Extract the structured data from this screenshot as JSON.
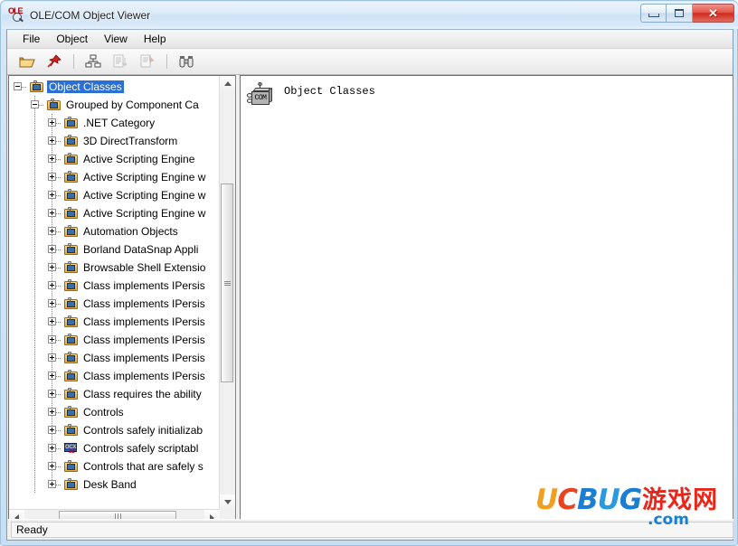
{
  "window": {
    "title": "OLE/COM Object Viewer",
    "app_icon": "ole-viewer-icon",
    "minimize_label": "–",
    "maximize_label": "□",
    "close_label": "✕"
  },
  "menu": {
    "items": [
      {
        "label": "File",
        "name": "menu-file"
      },
      {
        "label": "Object",
        "name": "menu-object"
      },
      {
        "label": "View",
        "name": "menu-view"
      },
      {
        "label": "Help",
        "name": "menu-help"
      }
    ]
  },
  "toolbar": {
    "buttons": [
      {
        "icon": "open-folder-icon",
        "enabled": true
      },
      {
        "icon": "red-pushpin-icon",
        "enabled": true
      },
      {
        "icon": "hierarchy-tree-icon",
        "enabled": true
      },
      {
        "icon": "list-sort-icon",
        "enabled": false
      },
      {
        "icon": "edit-document-icon",
        "enabled": false
      },
      {
        "icon": "binoculars-icon",
        "enabled": true
      }
    ]
  },
  "tree": {
    "root": {
      "label": "Object Classes",
      "icon": "folder-com-icon",
      "expanded": true,
      "selected": true
    },
    "group": {
      "label": "Grouped by Component Ca",
      "icon": "folder-com-icon",
      "expanded": true
    },
    "items": [
      {
        "label": ".NET Category",
        "icon": "folder-com-icon"
      },
      {
        "label": "3D DirectTransform",
        "icon": "folder-com-icon"
      },
      {
        "label": "Active Scripting Engine",
        "icon": "folder-com-icon"
      },
      {
        "label": "Active Scripting Engine w",
        "icon": "folder-com-icon"
      },
      {
        "label": "Active Scripting Engine w",
        "icon": "folder-com-icon"
      },
      {
        "label": "Active Scripting Engine w",
        "icon": "folder-com-icon"
      },
      {
        "label": "Automation Objects",
        "icon": "folder-com-icon"
      },
      {
        "label": "Borland DataSnap Appli",
        "icon": "folder-com-icon"
      },
      {
        "label": "Browsable Shell Extensio",
        "icon": "folder-com-icon"
      },
      {
        "label": "Class implements IPersis",
        "icon": "folder-com-icon"
      },
      {
        "label": "Class implements IPersis",
        "icon": "folder-com-icon"
      },
      {
        "label": "Class implements IPersis",
        "icon": "folder-com-icon"
      },
      {
        "label": "Class implements IPersis",
        "icon": "folder-com-icon"
      },
      {
        "label": "Class implements IPersis",
        "icon": "folder-com-icon"
      },
      {
        "label": "Class implements IPersis",
        "icon": "folder-com-icon"
      },
      {
        "label": "Class requires the ability",
        "icon": "folder-com-icon"
      },
      {
        "label": "Controls",
        "icon": "folder-com-icon"
      },
      {
        "label": "Controls safely initializab",
        "icon": "folder-com-icon"
      },
      {
        "label": "Controls safely scriptabl",
        "icon": "ocx32-icon"
      },
      {
        "label": "Controls that are safely s",
        "icon": "folder-com-icon"
      },
      {
        "label": "Desk Band",
        "icon": "folder-com-icon"
      }
    ]
  },
  "detail": {
    "icon": "com-object-icon",
    "icon_caption": "COM",
    "label": "Object Classes"
  },
  "scrollbars": {
    "vertical_up": "▲",
    "vertical_down": "▼",
    "horizontal_left": "◄",
    "horizontal_right": "►"
  },
  "status": {
    "text": "Ready"
  },
  "watermark": {
    "u": "U",
    "c": "C",
    "b": "B",
    "u2": "U",
    "g": "G",
    "chinese": "游戏网",
    "com": ".com"
  },
  "colors": {
    "selection": "#2a6fd6",
    "title_bar": "#d7e8f7",
    "close_button": "#cf2b20",
    "watermark_orange": "#f0a020",
    "watermark_red": "#e8451f",
    "watermark_blue": "#1a7fd4"
  }
}
